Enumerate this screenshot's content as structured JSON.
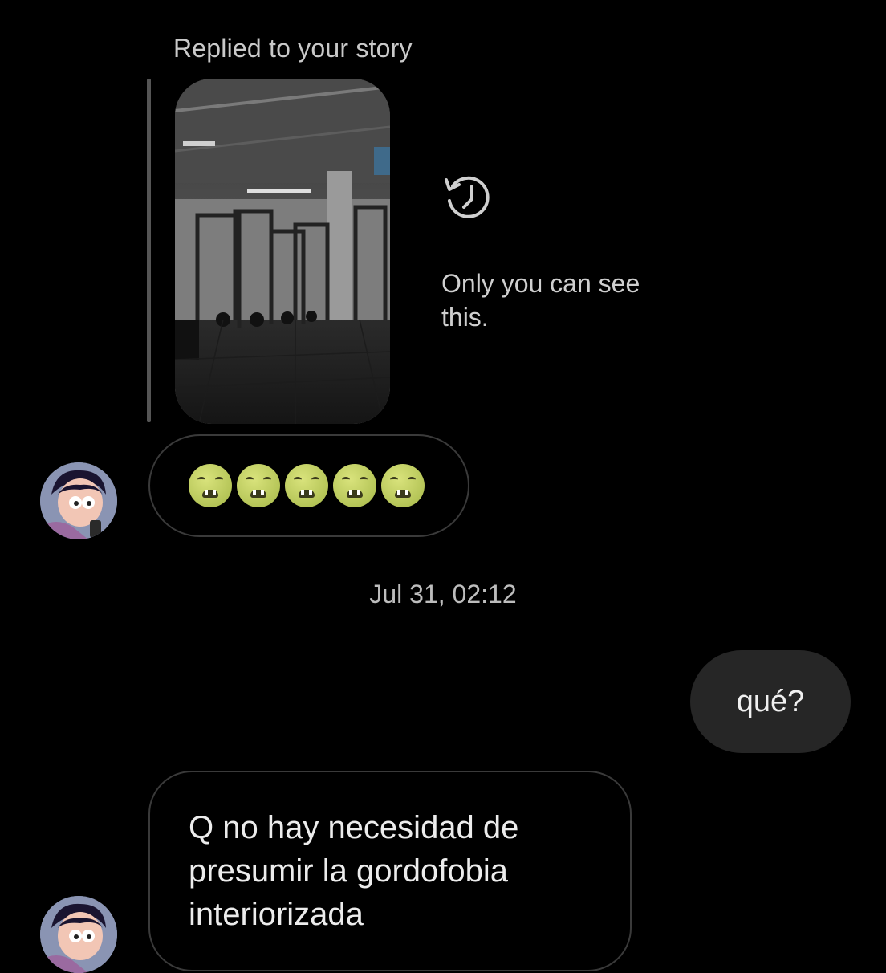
{
  "story_reply": {
    "label": "Replied to your story",
    "overlay_emoji": "💪💪💪",
    "notice": "Only you can see this.",
    "notice_icon": "history-icon"
  },
  "messages": {
    "reaction_emojis": [
      "🤢",
      "🤢",
      "🤢",
      "🤢",
      "🤢"
    ],
    "timestamp": "Jul 31, 02:12",
    "sent": "qué?",
    "received": "Q no hay necesidad de presumir la gordofobia interiorizada"
  },
  "colors": {
    "background": "#000000",
    "sent_bubble": "#262626",
    "outline": "#3a3a3a"
  }
}
